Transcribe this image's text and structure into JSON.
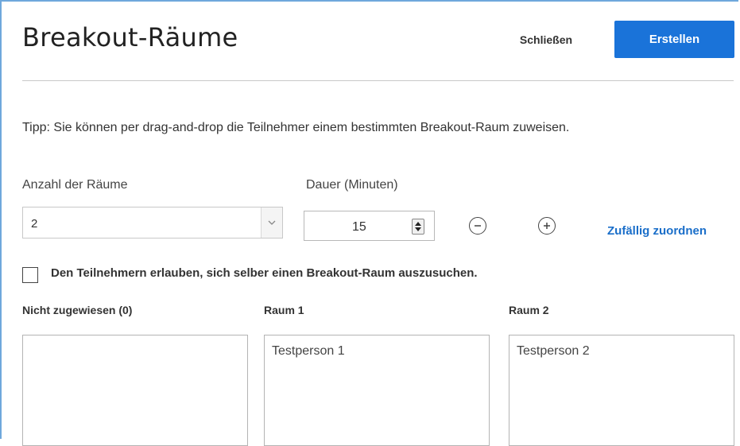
{
  "header": {
    "title": "Breakout-Räume",
    "close_label": "Schließen",
    "create_label": "Erstellen"
  },
  "tip": "Tipp: Sie können per drag-and-drop die Teilnehmer einem bestimmten Breakout-Raum zuweisen.",
  "rooms_count": {
    "label": "Anzahl der Räume",
    "value": "2"
  },
  "duration": {
    "label": "Dauer (Minuten)",
    "value": "15"
  },
  "icons": {
    "minus": "minus-circle-icon",
    "plus": "plus-circle-icon",
    "dropdown": "chevron-down-icon",
    "spinner": "spinner-arrows-icon"
  },
  "random_assign_label": "Zufällig zuordnen",
  "self_select": {
    "label": "Den Teilnehmern erlauben, sich selber einen Breakout-Raum auszusuchen.",
    "checked": false
  },
  "columns": [
    {
      "label": "Nicht zugewiesen (0)",
      "participants": []
    },
    {
      "label": "Raum 1",
      "participants": [
        "Testperson 1"
      ]
    },
    {
      "label": "Raum 2",
      "participants": [
        "Testperson 2"
      ]
    }
  ],
  "colors": {
    "primary": "#1a73d9",
    "link": "#1a6ec9",
    "window_border": "#6fa8dc"
  }
}
